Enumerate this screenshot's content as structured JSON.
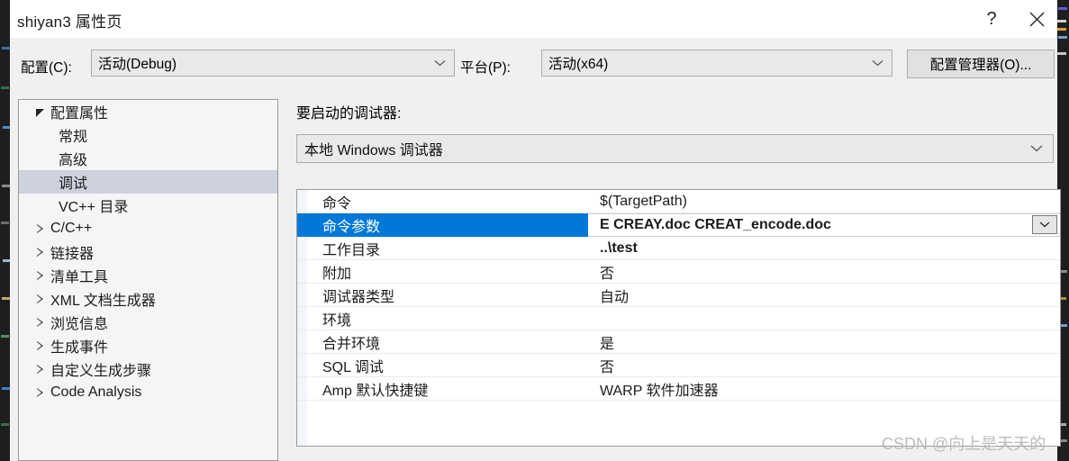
{
  "window": {
    "title": "shiyan3 属性页",
    "help_button": "?",
    "close_button": "✕",
    "help_icon": "question-mark-icon",
    "close_icon": "close-x-icon"
  },
  "config_bar": {
    "configuration_label": "配置(C):",
    "configuration_value": "活动(Debug)",
    "platform_label": "平台(P):",
    "platform_value": "活动(x64)",
    "config_manager_button": "配置管理器(O)..."
  },
  "tree": {
    "items": [
      {
        "label": "配置属性",
        "indent": 0,
        "arrow": "expanded",
        "selected": false
      },
      {
        "label": "常规",
        "indent": 1,
        "arrow": "none",
        "selected": false
      },
      {
        "label": "高级",
        "indent": 1,
        "arrow": "none",
        "selected": false
      },
      {
        "label": "调试",
        "indent": 1,
        "arrow": "none",
        "selected": true
      },
      {
        "label": "VC++ 目录",
        "indent": 1,
        "arrow": "none",
        "selected": false
      },
      {
        "label": "C/C++",
        "indent": 0,
        "arrow": "collapsed",
        "selected": false
      },
      {
        "label": "链接器",
        "indent": 0,
        "arrow": "collapsed",
        "selected": false
      },
      {
        "label": "清单工具",
        "indent": 0,
        "arrow": "collapsed",
        "selected": false
      },
      {
        "label": "XML 文档生成器",
        "indent": 0,
        "arrow": "collapsed",
        "selected": false
      },
      {
        "label": "浏览信息",
        "indent": 0,
        "arrow": "collapsed",
        "selected": false
      },
      {
        "label": "生成事件",
        "indent": 0,
        "arrow": "collapsed",
        "selected": false
      },
      {
        "label": "自定义生成步骤",
        "indent": 0,
        "arrow": "collapsed",
        "selected": false
      },
      {
        "label": "Code Analysis",
        "indent": 0,
        "arrow": "collapsed",
        "selected": false
      }
    ]
  },
  "main": {
    "debugger_label": "要启动的调试器:",
    "debugger_value": "本地 Windows 调试器",
    "properties": [
      {
        "name": "命令",
        "value": "$(TargetPath)",
        "bold": false,
        "selected": false
      },
      {
        "name": "命令参数",
        "value": "E CREAY.doc CREAT_encode.doc",
        "bold": true,
        "selected": true
      },
      {
        "name": "工作目录",
        "value": "..\\test",
        "bold": true,
        "selected": false
      },
      {
        "name": "附加",
        "value": "否",
        "bold": false,
        "selected": false
      },
      {
        "name": "调试器类型",
        "value": "自动",
        "bold": false,
        "selected": false
      },
      {
        "name": "环境",
        "value": "",
        "bold": false,
        "selected": false
      },
      {
        "name": "合并环境",
        "value": "是",
        "bold": false,
        "selected": false
      },
      {
        "name": "SQL 调试",
        "value": "否",
        "bold": false,
        "selected": false
      },
      {
        "name": "Amp 默认快捷键",
        "value": "WARP 软件加速器",
        "bold": false,
        "selected": false
      }
    ]
  },
  "watermark": {
    "text": "CSDN @向上是天天的"
  },
  "colors": {
    "selection_blue": "#0078d7",
    "tree_selection": "#cdd2de",
    "dialog_background": "#f0f0f0",
    "panel_background": "#f5f5f5",
    "grid_gutter": "#f2f5fa",
    "ide_dark": "#1e1e1e"
  }
}
